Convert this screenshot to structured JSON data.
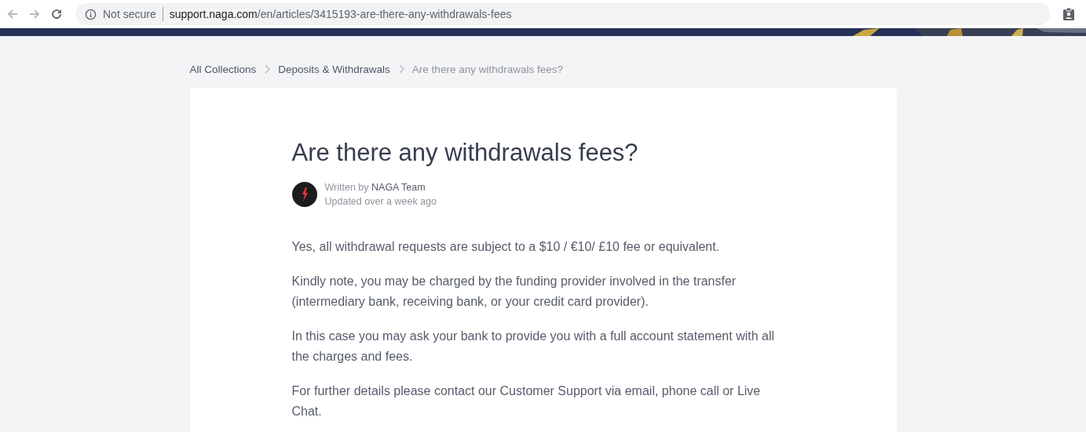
{
  "browser": {
    "security_label": "Not secure",
    "url_host": "support.naga.com",
    "url_path": "/en/articles/3415193-are-there-any-withdrawals-fees"
  },
  "breadcrumbs": [
    {
      "label": "All Collections",
      "current": false
    },
    {
      "label": "Deposits & Withdrawals",
      "current": false
    },
    {
      "label": "Are there any withdrawals fees?",
      "current": true
    }
  ],
  "article": {
    "title": "Are there any withdrawals fees?",
    "author_prefix": "Written by",
    "author": "NAGA Team",
    "updated": "Updated over a week ago",
    "paragraphs": [
      "Yes, all withdrawal requests are subject to a $10 / €10/ £10 fee or equivalent.",
      "Kindly note, you may be charged by the funding provider involved in the transfer (intermediary bank, receiving bank, or your credit card provider).",
      "In this case you may ask your bank to provide you with a full account statement with all the charges and fees.",
      "For further details please contact our Customer Support via email, phone call or Live Chat."
    ]
  }
}
